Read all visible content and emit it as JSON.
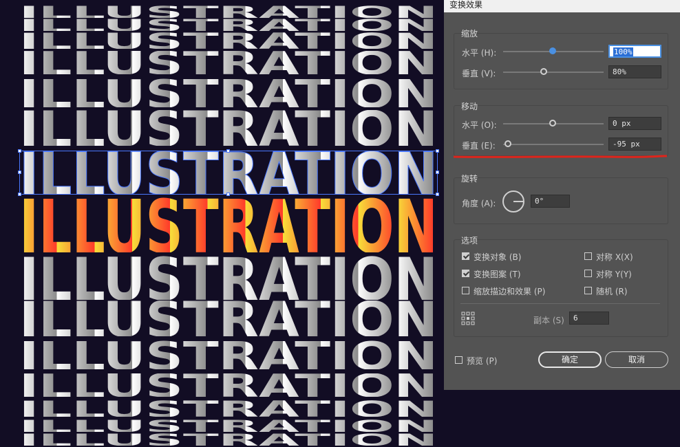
{
  "canvas": {
    "word": "ILLUSTRATION",
    "gradient_colors": [
      "#f7e03a",
      "#ff3a2a"
    ],
    "gray_colors": [
      "#ffffff",
      "#8a8a8a"
    ],
    "bg_color": "#120d24"
  },
  "dialog": {
    "title": "变换效果",
    "scale": {
      "title": "缩放",
      "h_label": "水平 (H):",
      "h_value": "100%",
      "v_label": "垂直 (V):",
      "v_value": "80%"
    },
    "move": {
      "title": "移动",
      "h_label": "水平 (O):",
      "h_value": "0 px",
      "v_label": "垂直 (E):",
      "v_value": "-95 px"
    },
    "rotate": {
      "title": "旋转",
      "angle_label": "角度 (A):",
      "angle_value": "0°"
    },
    "options": {
      "title": "选项",
      "transform_objects": {
        "label": "变换对象 (B)",
        "checked": true
      },
      "transform_patterns": {
        "label": "变换图案 (T)",
        "checked": true
      },
      "scale_strokes": {
        "label": "缩放描边和效果 (P)",
        "checked": false
      },
      "reflect_x": {
        "label": "对称 X(X)",
        "checked": false
      },
      "reflect_y": {
        "label": "对称 Y(Y)",
        "checked": false
      },
      "random": {
        "label": "随机 (R)",
        "checked": false
      },
      "copies_label": "副本 (S)",
      "copies_value": "6"
    },
    "preview": {
      "label": "预览 (P)",
      "checked": false
    },
    "ok_label": "确定",
    "cancel_label": "取消",
    "accent_color": "#4a90e2",
    "annotation_color": "#e0241b"
  }
}
